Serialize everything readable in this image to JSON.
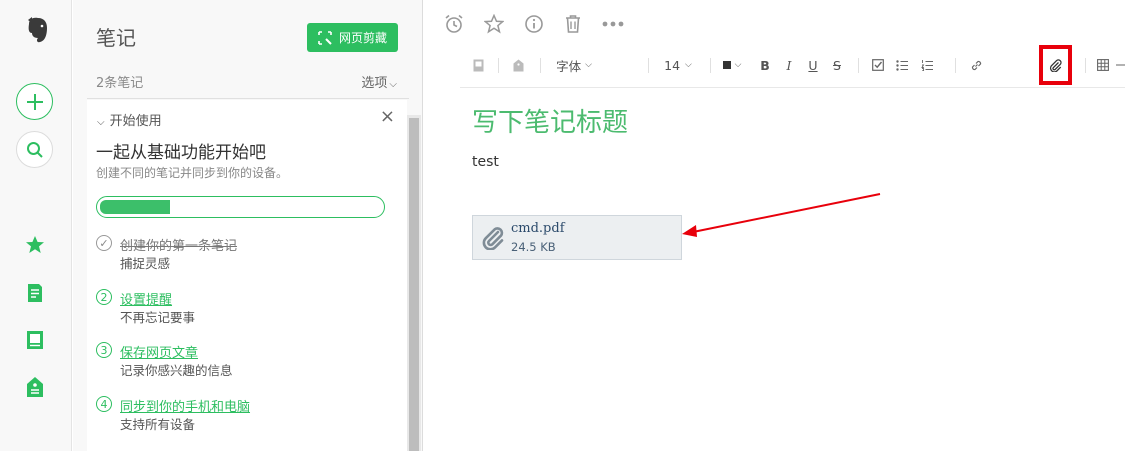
{
  "notes_pane": {
    "title": "笔记",
    "web_clip_label": "网页剪藏",
    "note_count": "2条笔记",
    "options_label": "选项"
  },
  "getting_started": {
    "header": "开始使用",
    "title": "一起从基础功能开始吧",
    "subtitle": "创建不同的笔记并同步到你的设备。",
    "progress_fraction": 0.25,
    "steps": [
      {
        "num": "✓",
        "label": "创建你的第一条笔记",
        "desc": "捕捉灵感",
        "done": true
      },
      {
        "num": "2",
        "label": "设置提醒",
        "desc": "不再忘记要事",
        "done": false
      },
      {
        "num": "3",
        "label": "保存网页文章",
        "desc": "记录你感兴趣的信息",
        "done": false
      },
      {
        "num": "4",
        "label": "同步到你的手机和电脑",
        "desc": "支持所有设备",
        "done": false
      }
    ]
  },
  "toolbar": {
    "font_label": "字体",
    "size_label": "14"
  },
  "note": {
    "title_placeholder": "写下笔记标题",
    "body": "test",
    "attachment": {
      "name": "cmd.pdf",
      "size": "24.5 KB"
    }
  },
  "colors": {
    "accent": "#2dbe60",
    "highlight": "#e8000b"
  }
}
